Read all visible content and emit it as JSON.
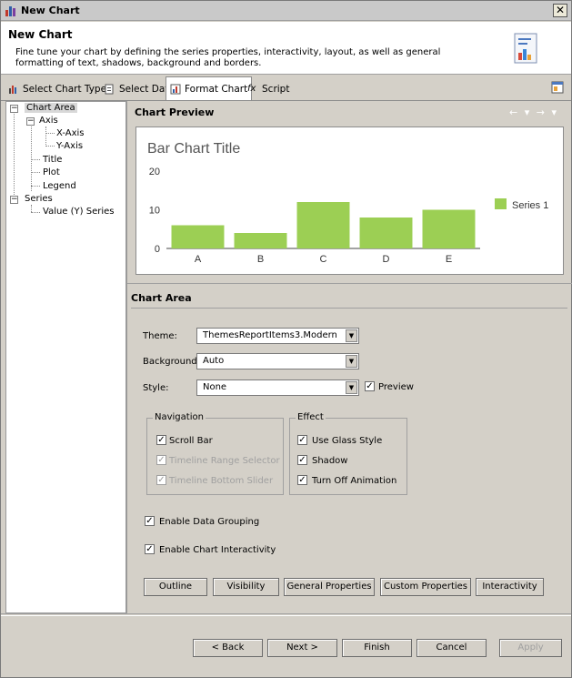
{
  "window": {
    "title": "New Chart",
    "close_glyph": "✕"
  },
  "header": {
    "title": "New Chart",
    "description": "Fine tune your chart by defining the series properties, interactivity, layout, as well as general formatting of text, shadows, background and borders."
  },
  "tabs": [
    {
      "label": "Select Chart Type",
      "icon": "chart-type-icon"
    },
    {
      "label": "Select Data",
      "icon": "data-icon"
    },
    {
      "label": "Format Chart",
      "icon": "format-icon",
      "active": true
    },
    {
      "label": "Script",
      "icon": "fx-icon"
    }
  ],
  "tree": {
    "items": [
      {
        "label": "Chart Area",
        "selected": true,
        "toggle": "−"
      },
      {
        "label": "Axis",
        "toggle": "−"
      },
      {
        "label": "X-Axis"
      },
      {
        "label": "Y-Axis"
      },
      {
        "label": "Title"
      },
      {
        "label": "Plot"
      },
      {
        "label": "Legend"
      },
      {
        "label": "Series",
        "toggle": "−"
      },
      {
        "label": "Value (Y) Series"
      }
    ]
  },
  "preview": {
    "heading": "Chart Preview",
    "nav_glyphs": "← ▾ → ▾"
  },
  "chart_data": {
    "type": "bar",
    "title": "Bar Chart Title",
    "categories": [
      "A",
      "B",
      "C",
      "D",
      "E"
    ],
    "series": [
      {
        "name": "Series 1",
        "values": [
          6,
          4,
          12,
          8,
          10
        ]
      }
    ],
    "ylim": [
      0,
      20
    ],
    "yticks": [
      "0",
      "10",
      "20"
    ],
    "xlabel": "",
    "ylabel": "",
    "legend": "right",
    "color": "#9ccf54",
    "grid": false
  },
  "chart_area": {
    "heading": "Chart Area",
    "theme": {
      "label": "Theme:",
      "value": "ThemesReportItems3.Modern"
    },
    "background": {
      "label": "Background:",
      "value": "Auto"
    },
    "style": {
      "label": "Style:",
      "value": "None"
    },
    "preview_check": {
      "label": "Preview",
      "checked": true
    },
    "navigation": {
      "title": "Navigation",
      "items": [
        {
          "label": "Scroll Bar",
          "checked": true,
          "enabled": true
        },
        {
          "label": "Timeline Range Selector",
          "checked": true,
          "enabled": false
        },
        {
          "label": "Timeline Bottom Slider",
          "checked": true,
          "enabled": false
        }
      ]
    },
    "effect": {
      "title": "Effect",
      "items": [
        {
          "label": "Use Glass Style",
          "checked": true
        },
        {
          "label": "Shadow",
          "checked": true
        },
        {
          "label": "Turn Off Animation",
          "checked": true
        }
      ]
    },
    "enable_data_grouping": {
      "label": "Enable Data Grouping",
      "checked": true
    },
    "enable_chart_interactivity": {
      "label": "Enable Chart Interactivity",
      "checked": true
    },
    "buttons": [
      "Outline",
      "Visibility",
      "General Properties",
      "Custom Properties",
      "Interactivity"
    ]
  },
  "footer": {
    "back": "< Back",
    "next": "Next >",
    "finish": "Finish",
    "cancel": "Cancel",
    "apply": "Apply"
  },
  "check_glyph": "✓"
}
